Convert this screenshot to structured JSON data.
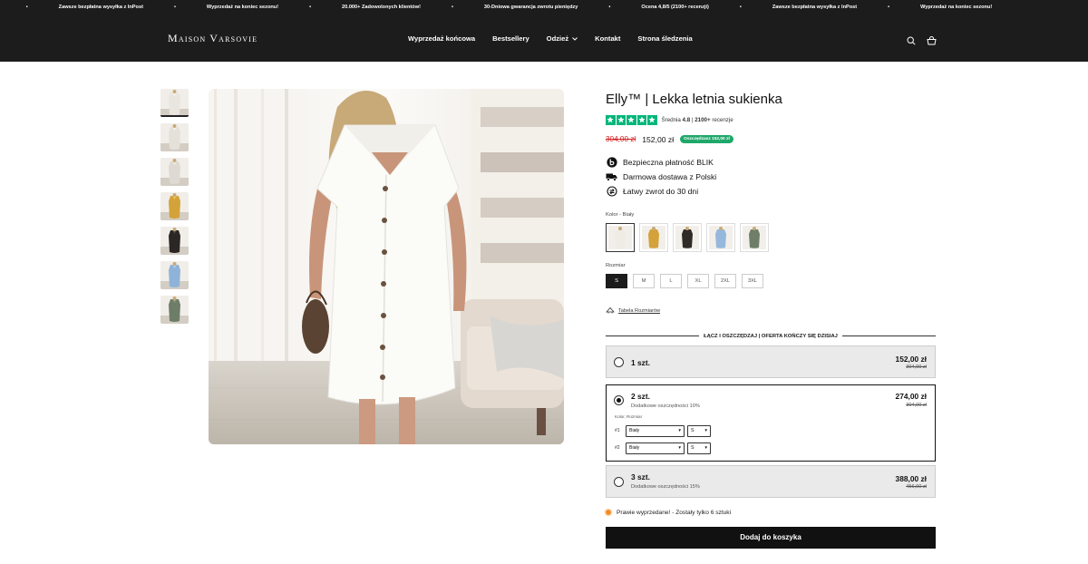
{
  "announcement": {
    "items": [
      "recenzji)",
      "Zawsze bezpłatna wysyłka z InPost",
      "Wyprzedaż na koniec sezonu!",
      "20.000+ Zadowolonych klientów!",
      "30-Dniowa gwarancja zwrotu pieniędzy",
      "Ocena 4,8/5 (2100+ recenzji)",
      "Zawsze bezpłatna wysyłka z InPost",
      "Wyprzedaż na koniec sezonu!"
    ],
    "separator": "•"
  },
  "header": {
    "logo": "Maison Varsovie",
    "nav": [
      {
        "label": "Wyprzedaż końcowa"
      },
      {
        "label": "Bestsellery"
      },
      {
        "label": "Odzież"
      },
      {
        "label": "Kontakt"
      },
      {
        "label": "Strona śledzenia"
      }
    ],
    "icons": [
      "search-icon",
      "cart-icon"
    ]
  },
  "gallery": {
    "thumbnails": [
      {
        "color": "white",
        "swatch": "#e9e6e0",
        "accent": "#f6f4ef"
      },
      {
        "color": "white",
        "swatch": "#e4e1db",
        "accent": "#f3f1ec"
      },
      {
        "color": "white",
        "swatch": "#dedad3",
        "accent": "#f0ede7"
      },
      {
        "color": "yellow",
        "swatch": "#d4a23a",
        "accent": "#e8c05a"
      },
      {
        "color": "black",
        "swatch": "#2a2724",
        "accent": "#4a4541"
      },
      {
        "color": "blue",
        "swatch": "#8fb3d8",
        "accent": "#b4cce6"
      },
      {
        "color": "green",
        "swatch": "#6e7d68",
        "accent": "#8e9b87"
      }
    ]
  },
  "product": {
    "title": "Elly™ | Lekka letnia sukienka",
    "rating": {
      "prefix": "Średnia ",
      "score": "4.8",
      "separator": " | ",
      "count": "2100+",
      "suffix": " recenzje"
    },
    "price": {
      "old": "304,00 zł",
      "new": "152,00 zł",
      "badge": "Oszczędzasz 152,00 zł"
    },
    "features": [
      {
        "icon": "blik-icon",
        "text": "Bezpieczna płatność BLIK"
      },
      {
        "icon": "truck-icon",
        "text": "Darmowa dostawa z Polski"
      },
      {
        "icon": "return-icon",
        "text": "Łatwy zwrot do 30 dni"
      }
    ],
    "color_label": "Kolor - Biały",
    "colors": [
      {
        "name": "Biały",
        "hex": "#efece6",
        "selected": true
      },
      {
        "name": "Żółty",
        "hex": "#d4a23a",
        "selected": false
      },
      {
        "name": "Czarny",
        "hex": "#2f2b28",
        "selected": false
      },
      {
        "name": "Niebieski",
        "hex": "#95b8dc",
        "selected": false
      },
      {
        "name": "Zielony",
        "hex": "#6f7e69",
        "selected": false
      }
    ],
    "size_label": "Rozmiar",
    "sizes": [
      {
        "label": "S",
        "selected": true
      },
      {
        "label": "M",
        "selected": false
      },
      {
        "label": "L",
        "selected": false
      },
      {
        "label": "XL",
        "selected": false
      },
      {
        "label": "2XL",
        "selected": false
      },
      {
        "label": "3XL",
        "selected": false
      }
    ],
    "size_table": "Tabela Rozmiarów",
    "bundle_heading": "ŁĄCZ I OSZCZĘDZAJ | OFERTA KOŃCZY SIĘ DZISIAJ",
    "bundles": [
      {
        "qty": "1 szt.",
        "sub": "",
        "price": "152,00 zł",
        "old": "304,00 zł",
        "selected": false
      },
      {
        "qty": "2 szt.",
        "sub": "Dodatkowe oszczędności 10%",
        "price": "274,00 zł",
        "old": "304,00 zł",
        "selected": true,
        "variant_label": "Kolor, Rozmiar",
        "variants": [
          {
            "num": "#1",
            "color": "Biały",
            "size": "S"
          },
          {
            "num": "#2",
            "color": "Biały",
            "size": "S"
          }
        ]
      },
      {
        "qty": "3 szt.",
        "sub": "Dodatkowe oszczędności 15%",
        "price": "388,00 zł",
        "old": "456,00 zł",
        "selected": false
      }
    ],
    "stock": "Prawie wyprzedane! - Zostały tylko 6 sztuki",
    "add_to_cart": "Dodaj do koszyka"
  },
  "colors": {
    "header_bg": "#1c1c1c",
    "trustpilot": "#00b67a",
    "save_badge": "#1fa86a",
    "old_price": "#d11a1a",
    "stock_dot": "#f28c28"
  }
}
